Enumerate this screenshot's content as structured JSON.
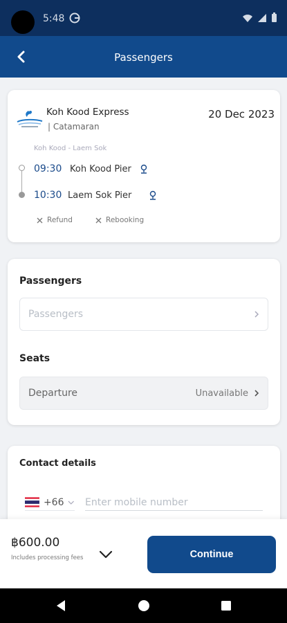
{
  "status_bar": {
    "time": "5:48"
  },
  "header": {
    "title": "Passengers"
  },
  "trip": {
    "operator": "Koh Kood Express",
    "vessel": "| Catamaran",
    "date": "20 Dec 2023",
    "route": "Koh Kood - Laem Sok",
    "departure": {
      "time": "09:30",
      "pier": "Koh Kood Pier"
    },
    "arrival": {
      "time": "10:30",
      "pier": "Laem Sok Pier"
    },
    "policies": [
      "Refund",
      "Rebooking"
    ]
  },
  "passengers": {
    "heading": "Passengers",
    "placeholder": "Passengers"
  },
  "seats": {
    "heading": "Seats",
    "label": "Departure",
    "status": "Unavailable"
  },
  "contact": {
    "heading": "Contact details",
    "country_code": "+66",
    "phone_placeholder": "Enter mobile number"
  },
  "footer": {
    "price": "฿600.00",
    "fee_note": "Includes processing fees",
    "continue_label": "Continue"
  },
  "colors": {
    "primary": "#114a8c",
    "status_bar": "#0d2f5e",
    "accent_text": "#1a4a8a"
  }
}
